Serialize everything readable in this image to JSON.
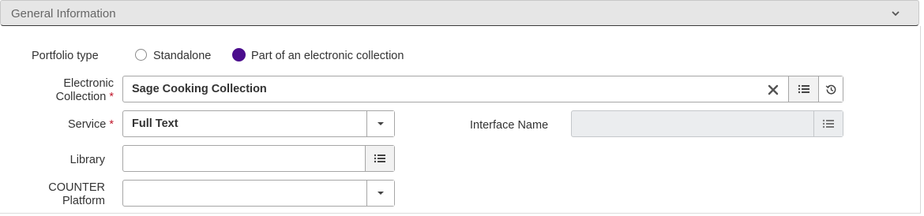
{
  "section": {
    "title": "General Information",
    "chevron_icon": "chevron-down-icon"
  },
  "portfolio_type": {
    "label": "Portfolio type",
    "options": [
      {
        "label": "Standalone",
        "selected": false
      },
      {
        "label": "Part of an electronic collection",
        "selected": true
      }
    ]
  },
  "electronic_collection": {
    "label_line1": "Electronic",
    "label_line2": "Collection",
    "required_mark": "*",
    "value": "Sage Cooking Collection",
    "clear_icon": "close-icon",
    "list_icon": "list-icon",
    "history_icon": "history-icon"
  },
  "service": {
    "label": "Service",
    "required_mark": "*",
    "value": "Full Text",
    "dropdown_icon": "caret-down-icon"
  },
  "interface_name": {
    "label": "Interface Name",
    "value": "",
    "list_icon": "list-icon"
  },
  "library": {
    "label": "Library",
    "value": "",
    "list_icon": "list-icon"
  },
  "counter_platform": {
    "label_line1": "COUNTER",
    "label_line2": "Platform",
    "value": "",
    "dropdown_icon": "caret-down-icon"
  },
  "colors": {
    "selected_radio": "#4b0d8d",
    "required": "#c0172b",
    "header_bg": "#e6e6e6"
  }
}
